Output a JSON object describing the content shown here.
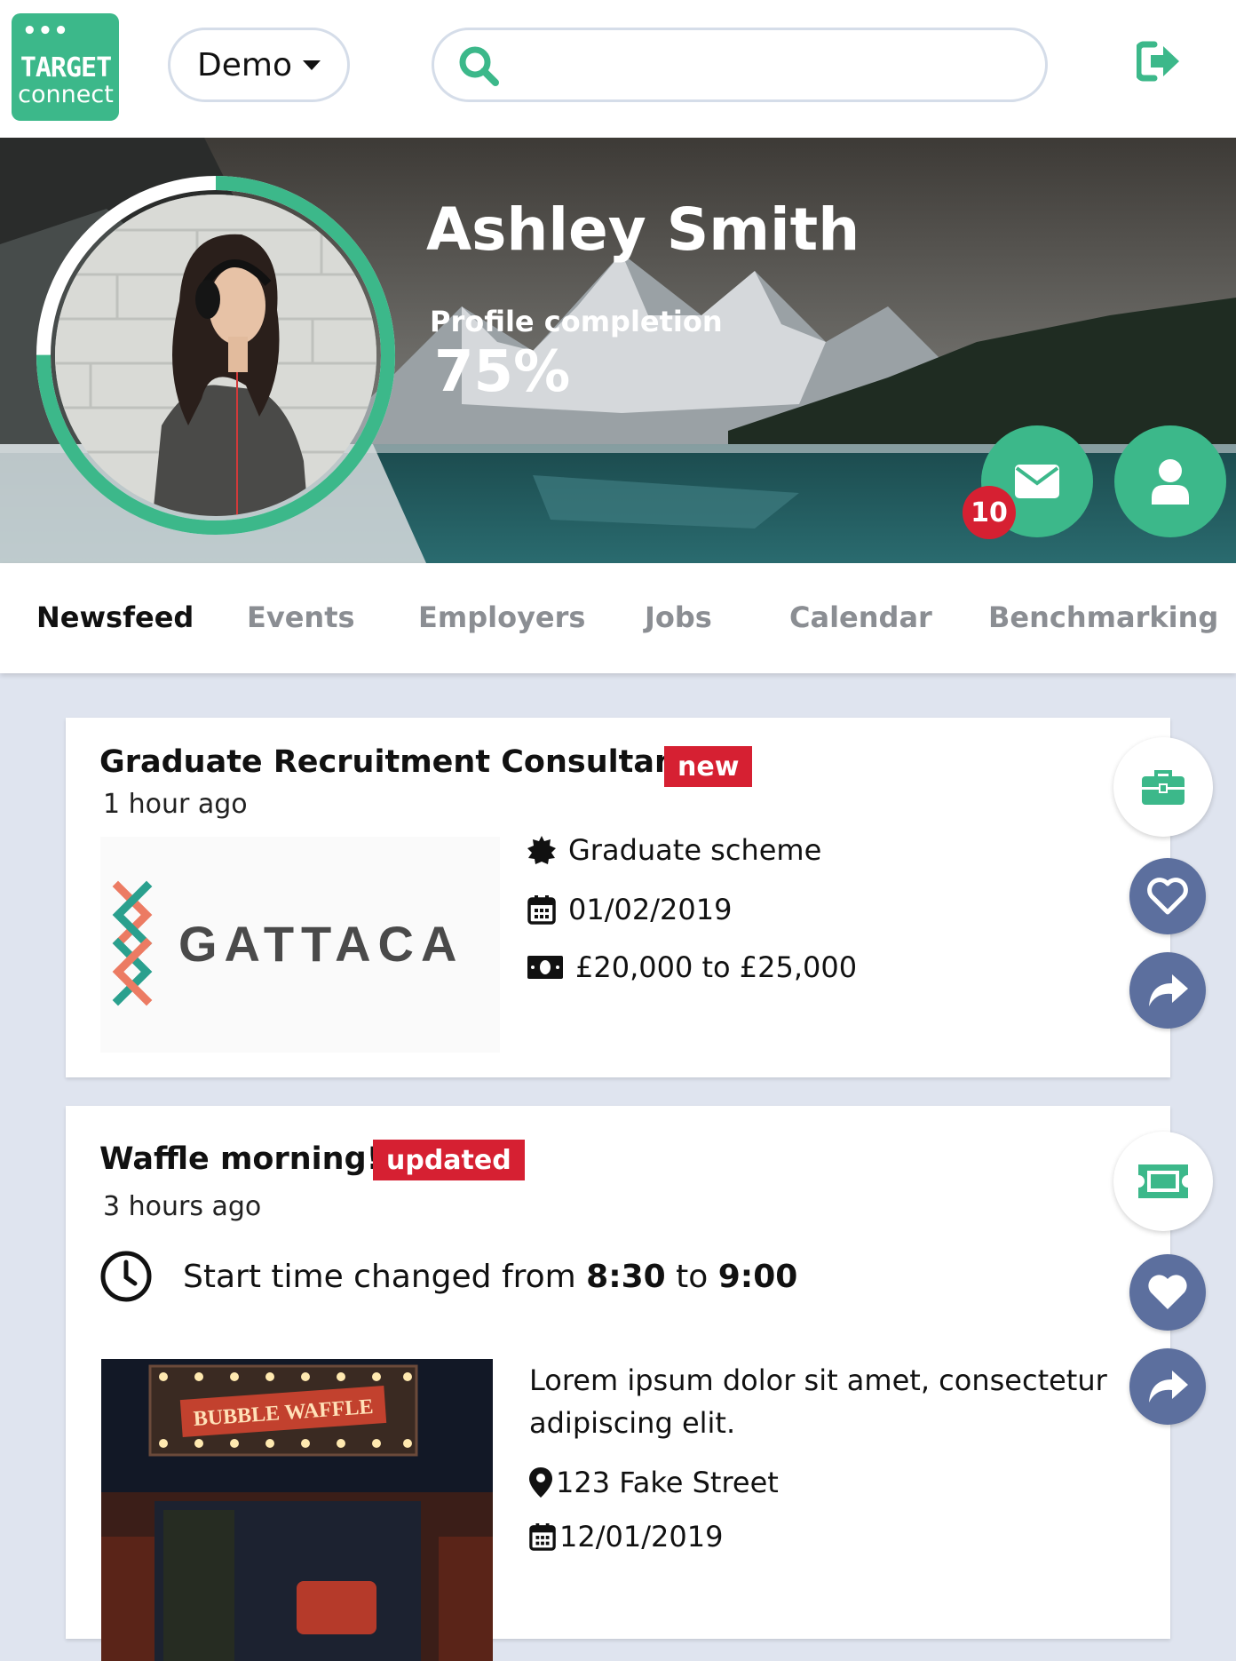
{
  "header": {
    "logo_line1": "TARGET",
    "logo_line2": "connect",
    "logo_dots": "•••",
    "dropdown_value": "Demo",
    "search_placeholder": ""
  },
  "profile": {
    "name": "Ashley Smith",
    "completion_label": "Profile completion",
    "completion_value": "75%",
    "completion_fraction": 0.75,
    "unread_messages": "10"
  },
  "tabs": [
    {
      "label": "Newsfeed",
      "active": true
    },
    {
      "label": "Events",
      "active": false
    },
    {
      "label": "Employers",
      "active": false
    },
    {
      "label": "Jobs",
      "active": false
    },
    {
      "label": "Calendar",
      "active": false
    },
    {
      "label": "Benchmarking",
      "active": false
    }
  ],
  "feed": [
    {
      "title": "Graduate Recruitment Consultant",
      "tag": "new",
      "time": "1 hour ago",
      "company_logo_text": "GATTACA",
      "details": [
        {
          "icon": "badge-icon",
          "text": "Graduate scheme"
        },
        {
          "icon": "calendar-icon",
          "text": "01/02/2019"
        },
        {
          "icon": "money-icon",
          "text": "£20,000 to £25,000"
        }
      ]
    },
    {
      "title": "Waffle morning!",
      "tag": "updated",
      "time": "3 hours ago",
      "change_prefix": "Start time changed from ",
      "change_from": "8:30",
      "change_mid": " to ",
      "change_to": "9:00",
      "description": "Lorem ipsum dolor sit amet, consectetur adipiscing elit.",
      "details": [
        {
          "icon": "map-pin-icon",
          "text": "123 Fake Street"
        },
        {
          "icon": "calendar-icon",
          "text": "12/01/2019"
        }
      ],
      "photo_sign": "BUBBLE WAFFLE"
    }
  ],
  "colors": {
    "brand_green": "#3cb88a",
    "alert_red": "#d62032",
    "action_blue": "#5c6f9e",
    "page_bg": "#dfe4ef"
  }
}
